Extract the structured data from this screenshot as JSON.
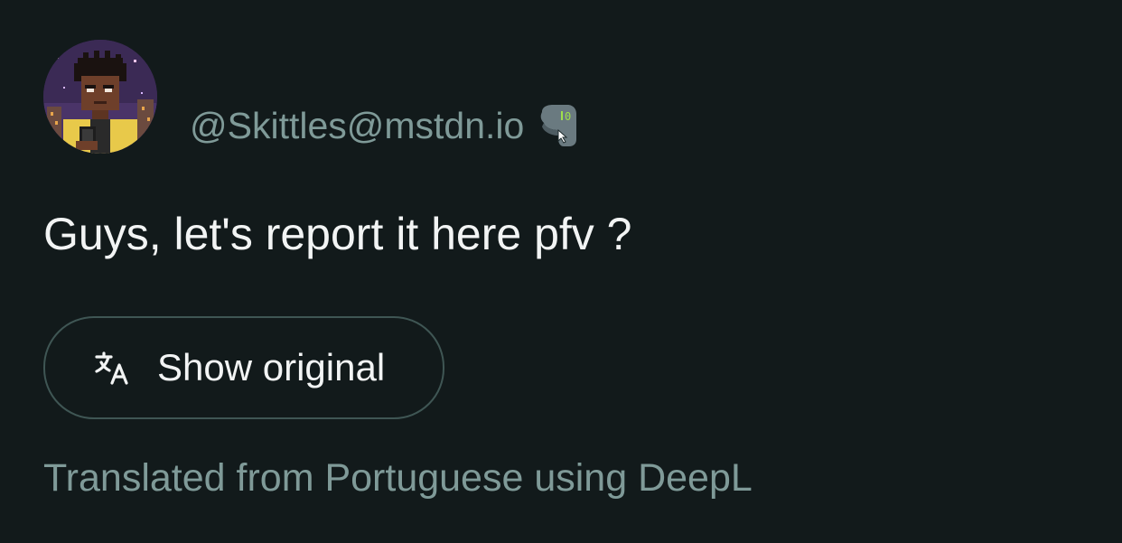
{
  "post": {
    "account_handle": "@Skittles@mstdn.io",
    "content": "Guys, let's report it here pfv ?",
    "handle_emoji_icon": "mastodon-elephant-emoji-icon"
  },
  "translation": {
    "button_label": "Show original",
    "button_icon": "translate-icon",
    "provider_text": "Translated from Portuguese using DeepL"
  },
  "colors": {
    "background": "#121a1b",
    "primary_text": "#f2f4f4",
    "secondary_text": "#7f9a98",
    "button_border": "#3f5654"
  }
}
